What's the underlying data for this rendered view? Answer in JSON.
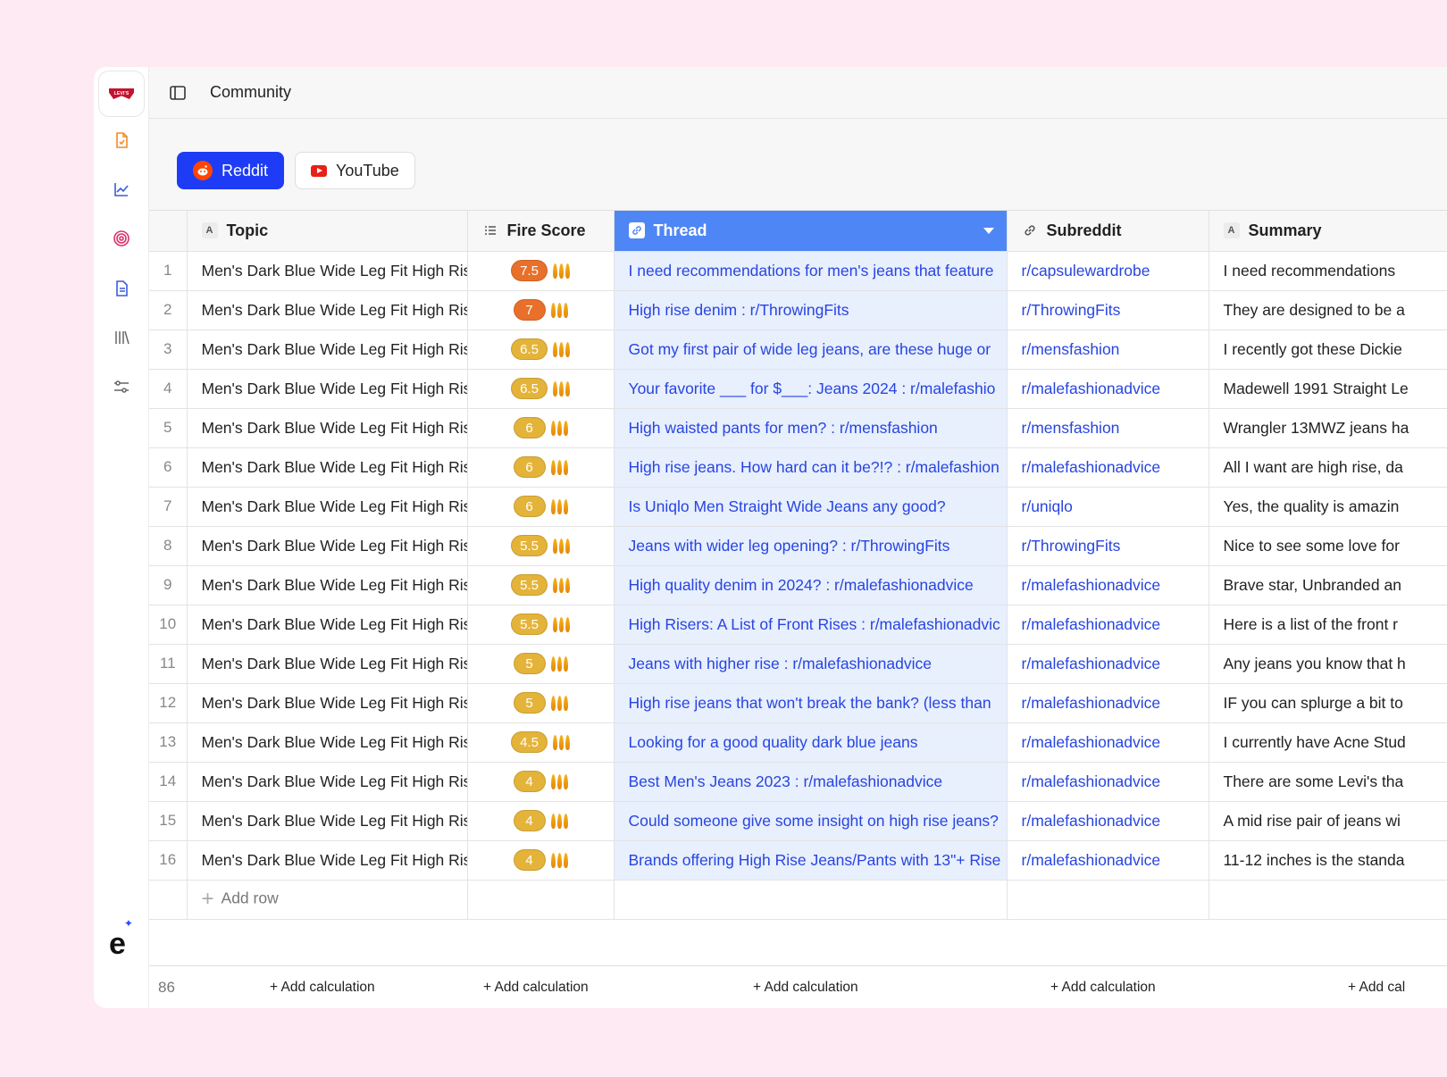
{
  "page": {
    "title": "Community"
  },
  "brand": {
    "logo_text": "LEVI'S",
    "mark": "e",
    "mark_sup": "✦"
  },
  "tabs": [
    {
      "label": "Reddit",
      "active": true
    },
    {
      "label": "YouTube",
      "active": false
    }
  ],
  "columns": {
    "topic": {
      "label": "Topic",
      "type_icon": "A"
    },
    "fire_score": {
      "label": "Fire Score",
      "type_icon": "list-icon"
    },
    "thread": {
      "label": "Thread",
      "type_icon": "link-icon"
    },
    "subreddit": {
      "label": "Subreddit",
      "type_icon": "link-icon"
    },
    "summary": {
      "label": "Summary",
      "type_icon": "A"
    }
  },
  "colors": {
    "accent": "#1e3cf5",
    "thread_header": "#4e86f5",
    "link": "#2745e0",
    "score_high": "#e8702a",
    "score_mid": "#e4b339"
  },
  "rows": [
    {
      "num": "1",
      "topic": "Men's Dark Blue Wide Leg Fit High Rise",
      "score": "7.5",
      "color": "#e8702a",
      "thread": "I need recommendations for men's jeans that feature",
      "sub": "r/capsulewardrobe",
      "summary": "I need recommendations"
    },
    {
      "num": "2",
      "topic": "Men's Dark Blue Wide Leg Fit High Rise",
      "score": "7",
      "color": "#e8702a",
      "thread": "High rise denim : r/ThrowingFits",
      "sub": "r/ThrowingFits",
      "summary": "They are designed to be a"
    },
    {
      "num": "3",
      "topic": "Men's Dark Blue Wide Leg Fit High Rise",
      "score": "6.5",
      "color": "#e4b339",
      "thread": "Got my first pair of wide leg jeans, are these huge or",
      "sub": "r/mensfashion",
      "summary": "I recently got these Dickie"
    },
    {
      "num": "4",
      "topic": "Men's Dark Blue Wide Leg Fit High Rise",
      "score": "6.5",
      "color": "#e4b339",
      "thread": "Your favorite ___ for $___: Jeans 2024 : r/malefashio",
      "sub": "r/malefashionadvice",
      "summary": "Madewell 1991 Straight Le"
    },
    {
      "num": "5",
      "topic": "Men's Dark Blue Wide Leg Fit High Rise",
      "score": "6",
      "color": "#e4b339",
      "thread": "High waisted pants for men? : r/mensfashion",
      "sub": "r/mensfashion",
      "summary": "Wrangler 13MWZ jeans ha"
    },
    {
      "num": "6",
      "topic": "Men's Dark Blue Wide Leg Fit High Rise",
      "score": "6",
      "color": "#e4b339",
      "thread": "High rise jeans. How hard can it be?!? : r/malefashion",
      "sub": "r/malefashionadvice",
      "summary": "All I want are high rise, da"
    },
    {
      "num": "7",
      "topic": "Men's Dark Blue Wide Leg Fit High Rise",
      "score": "6",
      "color": "#e4b339",
      "thread": "Is Uniqlo Men Straight Wide Jeans any good?",
      "sub": "r/uniqlo",
      "summary": "Yes, the quality is amazin"
    },
    {
      "num": "8",
      "topic": "Men's Dark Blue Wide Leg Fit High Rise",
      "score": "5.5",
      "color": "#e4b339",
      "thread": "Jeans with wider leg opening? : r/ThrowingFits",
      "sub": "r/ThrowingFits",
      "summary": "Nice to see some love for"
    },
    {
      "num": "9",
      "topic": "Men's Dark Blue Wide Leg Fit High Rise",
      "score": "5.5",
      "color": "#e4b339",
      "thread": "High quality denim in 2024? : r/malefashionadvice",
      "sub": "r/malefashionadvice",
      "summary": "Brave star, Unbranded an"
    },
    {
      "num": "10",
      "topic": "Men's Dark Blue Wide Leg Fit High Rise",
      "score": "5.5",
      "color": "#e4b339",
      "thread": "High Risers: A List of Front Rises : r/malefashionadvic",
      "sub": "r/malefashionadvice",
      "summary": "Here is a list of the front r"
    },
    {
      "num": "11",
      "topic": "Men's Dark Blue Wide Leg Fit High Rise",
      "score": "5",
      "color": "#e4b339",
      "thread": "Jeans with higher rise : r/malefashionadvice",
      "sub": "r/malefashionadvice",
      "summary": "Any jeans you know that h"
    },
    {
      "num": "12",
      "topic": "Men's Dark Blue Wide Leg Fit High Rise",
      "score": "5",
      "color": "#e4b339",
      "thread": "High rise jeans that won't break the bank? (less than",
      "sub": "r/malefashionadvice",
      "summary": "IF you can splurge a bit to"
    },
    {
      "num": "13",
      "topic": "Men's Dark Blue Wide Leg Fit High Rise",
      "score": "4.5",
      "color": "#e4b339",
      "thread": "Looking for a good quality dark blue jeans",
      "sub": "r/malefashionadvice",
      "summary": "I currently have Acne Stud"
    },
    {
      "num": "14",
      "topic": "Men's Dark Blue Wide Leg Fit High Rise",
      "score": "4",
      "color": "#e4b339",
      "thread": "Best Men's Jeans 2023 : r/malefashionadvice",
      "sub": "r/malefashionadvice",
      "summary": "There are some Levi's tha"
    },
    {
      "num": "15",
      "topic": "Men's Dark Blue Wide Leg Fit High Rise",
      "score": "4",
      "color": "#e4b339",
      "thread": "Could someone give some insight on high rise jeans?",
      "sub": "r/malefashionadvice",
      "summary": "A mid rise pair of jeans wi"
    },
    {
      "num": "16",
      "topic": "Men's Dark Blue Wide Leg Fit High Rise",
      "score": "4",
      "color": "#e4b339",
      "thread": "Brands offering High Rise Jeans/Pants with 13\"+ Rise",
      "sub": "r/malefashionadvice",
      "summary": "11-12 inches is the standa"
    }
  ],
  "add_row_label": "Add row",
  "footer": {
    "count": "86",
    "calc_labels": [
      "+ Add calculation",
      "+ Add calculation",
      "+ Add calculation",
      "+ Add calculation",
      "+ Add cal"
    ]
  }
}
